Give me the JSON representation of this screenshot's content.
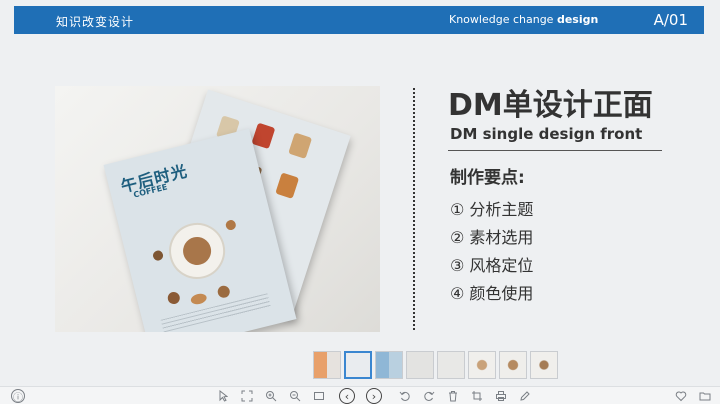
{
  "header": {
    "left_title": "知识改变设计",
    "en_title_normal": "Knowledge change ",
    "en_title_bold": "design",
    "page_code": "A/01"
  },
  "slide": {
    "title": "DM单设计正面",
    "subtitle": "DM single design front",
    "points_title": "制作要点:",
    "points": [
      "① 分析主题",
      "② 素材选用",
      "③ 风格定位",
      "④ 颜色使用"
    ]
  },
  "photo": {
    "poster_title": "午后时光",
    "poster_sub": "COFFEE"
  },
  "thumbnails": {
    "count": 8,
    "active_index": 1
  },
  "toolbar": {
    "info": "ⓘ",
    "prev": "‹",
    "next": "›"
  },
  "colors": {
    "header_bg": "#1f6fb6",
    "accent": "#3a86d0"
  }
}
